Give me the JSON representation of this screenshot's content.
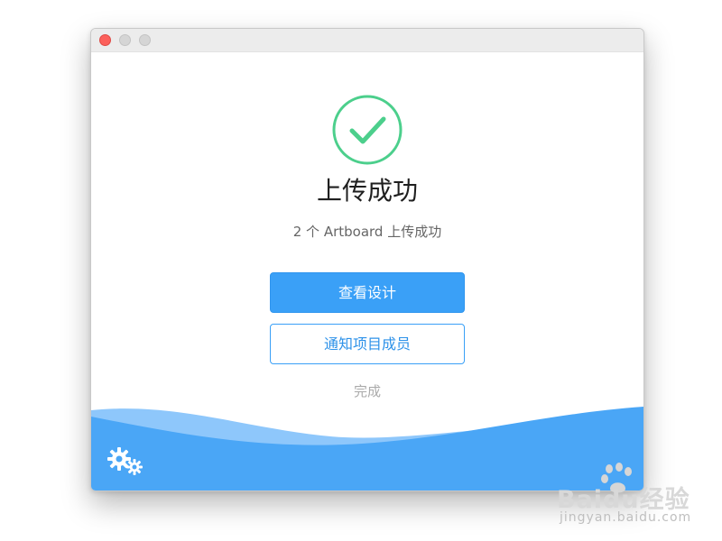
{
  "window": {
    "controls": [
      "close-button",
      "minimize-button",
      "maximize-button"
    ]
  },
  "status": {
    "title": "上传成功",
    "subtitle": "2 个 Artboard 上传成功",
    "icon": "check-circle-icon"
  },
  "actions": {
    "primary_label": "查看设计",
    "secondary_label": "通知项目成员",
    "done_label": "完成"
  },
  "footer": {
    "settings_icon": "gears-icon",
    "watermark_brand": "Baidu经验",
    "watermark_site": "jingyan.baidu.com"
  },
  "colors": {
    "accent": "#3aa0f7",
    "success": "#4ccf8c",
    "wave": "#4aa6f6"
  }
}
